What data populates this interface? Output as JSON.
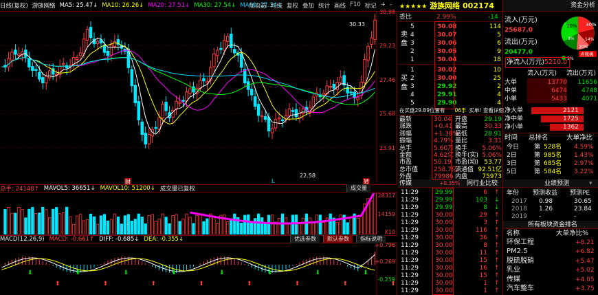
{
  "chart_header": {
    "items": [
      {
        "label": "日线(复权)",
        "color": "#e8e8e8"
      },
      {
        "label": "游族网络",
        "color": "#e8e8e8"
      },
      {
        "label": "MA5: 25.47↓",
        "color": "#ffffff"
      },
      {
        "label": "MA10: 26.26↓",
        "color": "#ffff00"
      },
      {
        "label": "MA20: 27.51↓",
        "color": "#ff00ff"
      },
      {
        "label": "MA30: 27.54↓",
        "color": "#00ff00"
      },
      {
        "label": "MA60: 27.34↓",
        "color": "#00d8ff"
      }
    ],
    "tools": [
      "加自选",
      "均线",
      "复权",
      "叠加",
      "统计",
      "画线",
      "F10",
      "标记",
      "+",
      "-"
    ]
  },
  "price_axis": {
    "labels": [
      "30.98",
      "29.23",
      "27.46",
      "25.68",
      "23.91"
    ],
    "annotations": {
      "high": "30.33",
      "low": "22.58",
      "marker_cai": "财",
      "marker_l": "L",
      "marker_zhuan": "转"
    },
    "colors": {
      "up": "#ff3c3c",
      "down": "#00e8ff",
      "ma5": "#ffffff",
      "ma10": "#ffff00",
      "ma20": "#ff00ff",
      "ma30": "#00ff00",
      "ma60": "#00d8ff"
    }
  },
  "volume_panel": {
    "header": [
      {
        "label": "总手: 24148↑",
        "color": "#ff3c3c"
      },
      {
        "label": "MAVOL5: 36651↓",
        "color": "#ffffff"
      },
      {
        "label": "MAVOL10: 51200↓",
        "color": "#ffff00"
      },
      {
        "label": "成交量已复权",
        "color": "#e8e8e8"
      }
    ],
    "tab": "成交量",
    "axis": [
      "28317",
      "14159",
      "X10"
    ]
  },
  "macd_panel": {
    "header": [
      {
        "label": "MACD(12,26,9)",
        "color": "#e8e8e8"
      },
      {
        "label": "MACD: -0.661↑",
        "color": "#ff3c3c"
      },
      {
        "label": "DIFF: -0.685↓",
        "color": "#ffffff"
      },
      {
        "label": "DEA: -0.355↓",
        "color": "#ffff00"
      }
    ],
    "buttons": [
      "优选参数",
      "默认参数",
      "指标说明"
    ],
    "axis": [
      "+0.796",
      "+0.269",
      "-0.259"
    ]
  },
  "quote": {
    "stars": "★★★★★",
    "name": "游族网络",
    "code": "002174",
    "webi_label": "委比",
    "webi_value": "2.99%",
    "webi_diff": "-14",
    "sell_label": [
      "卖",
      "盘"
    ],
    "buy_label": [
      "买",
      "盘"
    ],
    "sell_levels": [
      {
        "lv": "5",
        "price": "30.08",
        "vol": "114"
      },
      {
        "lv": "4",
        "price": "30.07",
        "vol": "5"
      },
      {
        "lv": "3",
        "price": "30.06",
        "vol": "6"
      },
      {
        "lv": "2",
        "price": "30.05",
        "vol": "9"
      },
      {
        "lv": "1",
        "price": "30.04",
        "vol": "18"
      }
    ],
    "buy_levels": [
      {
        "lv": "1",
        "price": "30.02",
        "vol": "10"
      },
      {
        "lv": "2",
        "price": "30.00",
        "vol": "25"
      },
      {
        "lv": "3",
        "price": "29.92",
        "vol": "2"
      },
      {
        "lv": "4",
        "price": "29.91",
        "vol": "4"
      },
      {
        "lv": "5",
        "price": "29.90",
        "vol": "4"
      }
    ],
    "tail_left": "在买盘29.89位置有",
    "tail_mid": "06手",
    "tail_right": "买单! 查看详细",
    "stats": [
      {
        "l": "最新",
        "v": "30.04",
        "l2": "开盘",
        "v2": "29.19"
      },
      {
        "l": "涨跌",
        "v": "+0.41",
        "l2": "最高",
        "v2": "30.33"
      },
      {
        "l": "涨幅",
        "v": "+1.38%",
        "l2": "最低",
        "v2": "28.91"
      },
      {
        "l": "振幅",
        "v": "4.79%",
        "l2": "量比",
        "v2": "3.31"
      },
      {
        "l": "总手",
        "v": "5.60万",
        "l2": "换手",
        "v2": "5.06%"
      },
      {
        "l": "金额",
        "v": "4.62亿",
        "l2": "换手(实)",
        "v2": "5.06%"
      },
      {
        "l": "市盈",
        "v": "50.19",
        "l2": "市盈(动)",
        "v2": "53.77"
      },
      {
        "l": "总市值",
        "v": "258.7亿",
        "l2": "流通值",
        "v2": "92.51亿"
      },
      {
        "l": "外盘",
        "v": "79986",
        "l2": "内盘",
        "v2": "75973"
      }
    ]
  },
  "trades": {
    "header": [
      "传媒",
      "+0.35%",
      "同行业比较"
    ],
    "rows": [
      {
        "t": "11:29",
        "p": "29.99",
        "v": "6",
        "a": "↑"
      },
      {
        "t": "11:29",
        "p": "29.99",
        "v": "103",
        "a": "↓"
      },
      {
        "t": "11:29",
        "p": "29.99",
        "v": "8",
        "a": "↓"
      },
      {
        "t": "11:29",
        "p": "30.00",
        "v": "29",
        "a": "↑"
      },
      {
        "t": "11:29",
        "p": "30.00",
        "v": "3",
        "a": "↑"
      },
      {
        "t": "11:29",
        "p": "30.00",
        "v": "116",
        "a": "↑"
      },
      {
        "t": "11:29",
        "p": "30.00",
        "v": "36",
        "a": "↑"
      },
      {
        "t": "11:29",
        "p": "30.00",
        "v": "8",
        "a": "↑"
      },
      {
        "t": "11:29",
        "p": "30.00",
        "v": "11",
        "a": "↑"
      },
      {
        "t": "11:29",
        "p": "30.00",
        "v": "15",
        "a": "↑"
      },
      {
        "t": "11:29",
        "p": "30.00",
        "v": "16",
        "a": "↑"
      },
      {
        "t": "11:29",
        "p": "30.00",
        "v": "15",
        "a": "↑"
      },
      {
        "t": "11:29",
        "p": "30.00",
        "v": "1",
        "a": "↑"
      },
      {
        "t": "11:29",
        "p": "30.00",
        "v": "1",
        "a": "↑"
      }
    ]
  },
  "funds": {
    "title": "资金分析",
    "pie": {
      "pct_big": "30%",
      "pct_mid1": "10%",
      "pct_small1": "9%",
      "pct_mid2": "14%",
      "pct_small2": "20%",
      "legend": "5%",
      "badge": "点我挑"
    },
    "inflow_label": "流入(万元)",
    "inflow_value": "25687.0",
    "outflow_label": "流出(万元)",
    "outflow_value": "20477.0",
    "net_label": "净流入(万元)",
    "net_value": "5210.0",
    "flow_header": [
      "流入(万元)",
      "流出(万元)"
    ],
    "flows": [
      {
        "l": "大单",
        "in": "13770",
        "out": "11656"
      },
      {
        "l": "中单",
        "in": "6474",
        "out": "4748"
      },
      {
        "l": "小单",
        "in": "5433",
        "out": "4071"
      }
    ],
    "net": [
      {
        "l": "净大单",
        "v": "2121",
        "pct": 1.0
      },
      {
        "l": "净中单",
        "v": "1725",
        "pct": 0.81
      },
      {
        "l": "净小单",
        "v": "1362",
        "pct": 0.64
      }
    ]
  },
  "rank": {
    "header": [
      "时间",
      "总排名",
      "大单净比"
    ],
    "rows": [
      {
        "t": "今日",
        "r": "528名",
        "v": "4.59%"
      },
      {
        "t": "2日",
        "r": "985名",
        "v": "1.43%"
      },
      {
        "t": "3日",
        "r": "685名",
        "v": "2.97%"
      },
      {
        "t": "5日",
        "r": "584名",
        "v": "3.22%"
      }
    ],
    "r_prefix": "第"
  },
  "forecast": {
    "title": "业绩预测",
    "cols": [
      "年份",
      "预测收益",
      "预测PE"
    ],
    "rows": [
      {
        "y": "2017",
        "e": "0.98",
        "pe": "30.65"
      },
      {
        "y": "2018",
        "e": "1.26",
        "pe": "23.84"
      },
      {
        "y": "2019",
        "e": "-",
        "pe": "-"
      }
    ]
  },
  "sectors": {
    "title": "所有板块资金排名",
    "cols": [
      "名称",
      "大单净比%"
    ],
    "rows": [
      {
        "n": "环保工程",
        "v": "+8.21"
      },
      {
        "n": "PM2.5",
        "v": "+6.82"
      },
      {
        "n": "脱硫脱硝",
        "v": "+5.47"
      },
      {
        "n": "乳业",
        "v": "+5.02"
      },
      {
        "n": "传媒",
        "v": "+4.05"
      },
      {
        "n": "汽车整车",
        "v": "+3.75"
      }
    ]
  }
}
